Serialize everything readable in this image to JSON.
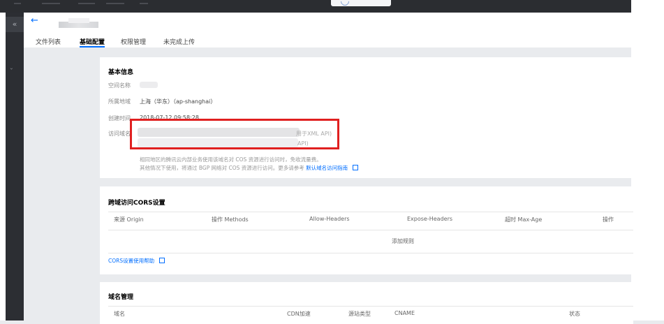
{
  "top": {},
  "sidebar": {
    "collapse_label": "«",
    "chevron": "›"
  },
  "header": {
    "back_icon": "←",
    "tabs": [
      "文件列表",
      "基础配置",
      "权限管理",
      "未完成上传"
    ],
    "active_tab": 1
  },
  "basic_info": {
    "title": "基本信息",
    "bucket_name_label": "空间名称",
    "region_label": "所属地域",
    "region_value": "上海（华东）（ap-shanghai）",
    "created_label": "创建时间",
    "created_value": "2018-07-12 09:58:28",
    "domain_label": "访问域名",
    "domain_suffix_1": "用于XML API)",
    "domain_suffix_2": "API)",
    "note_line1": "相同地区的腾讯云内部业务使用该域名对 COS 资源进行访问时，免收流量费。",
    "note_line2_prefix": "其他情况下使用，将通过 BGP 网络对 COS 资源进行访问。更多请参考",
    "note_line2_link": "默认域名访问指南"
  },
  "cors": {
    "title": "跨域访问CORS设置",
    "columns": [
      "来源 Origin",
      "操作 Methods",
      "Allow-Headers",
      "Expose-Headers",
      "超时 Max-Age",
      "操作"
    ],
    "add_rule": "添加规则",
    "help_link": "CORS设置使用帮助"
  },
  "domain_mgmt": {
    "title": "域名管理",
    "columns": [
      "域名",
      "CDN加速",
      "源站类型",
      "CNAME",
      "状态"
    ]
  },
  "colors": {
    "accent": "#006eff",
    "highlight": "#e02020",
    "sidebar": "#2c2e33"
  }
}
